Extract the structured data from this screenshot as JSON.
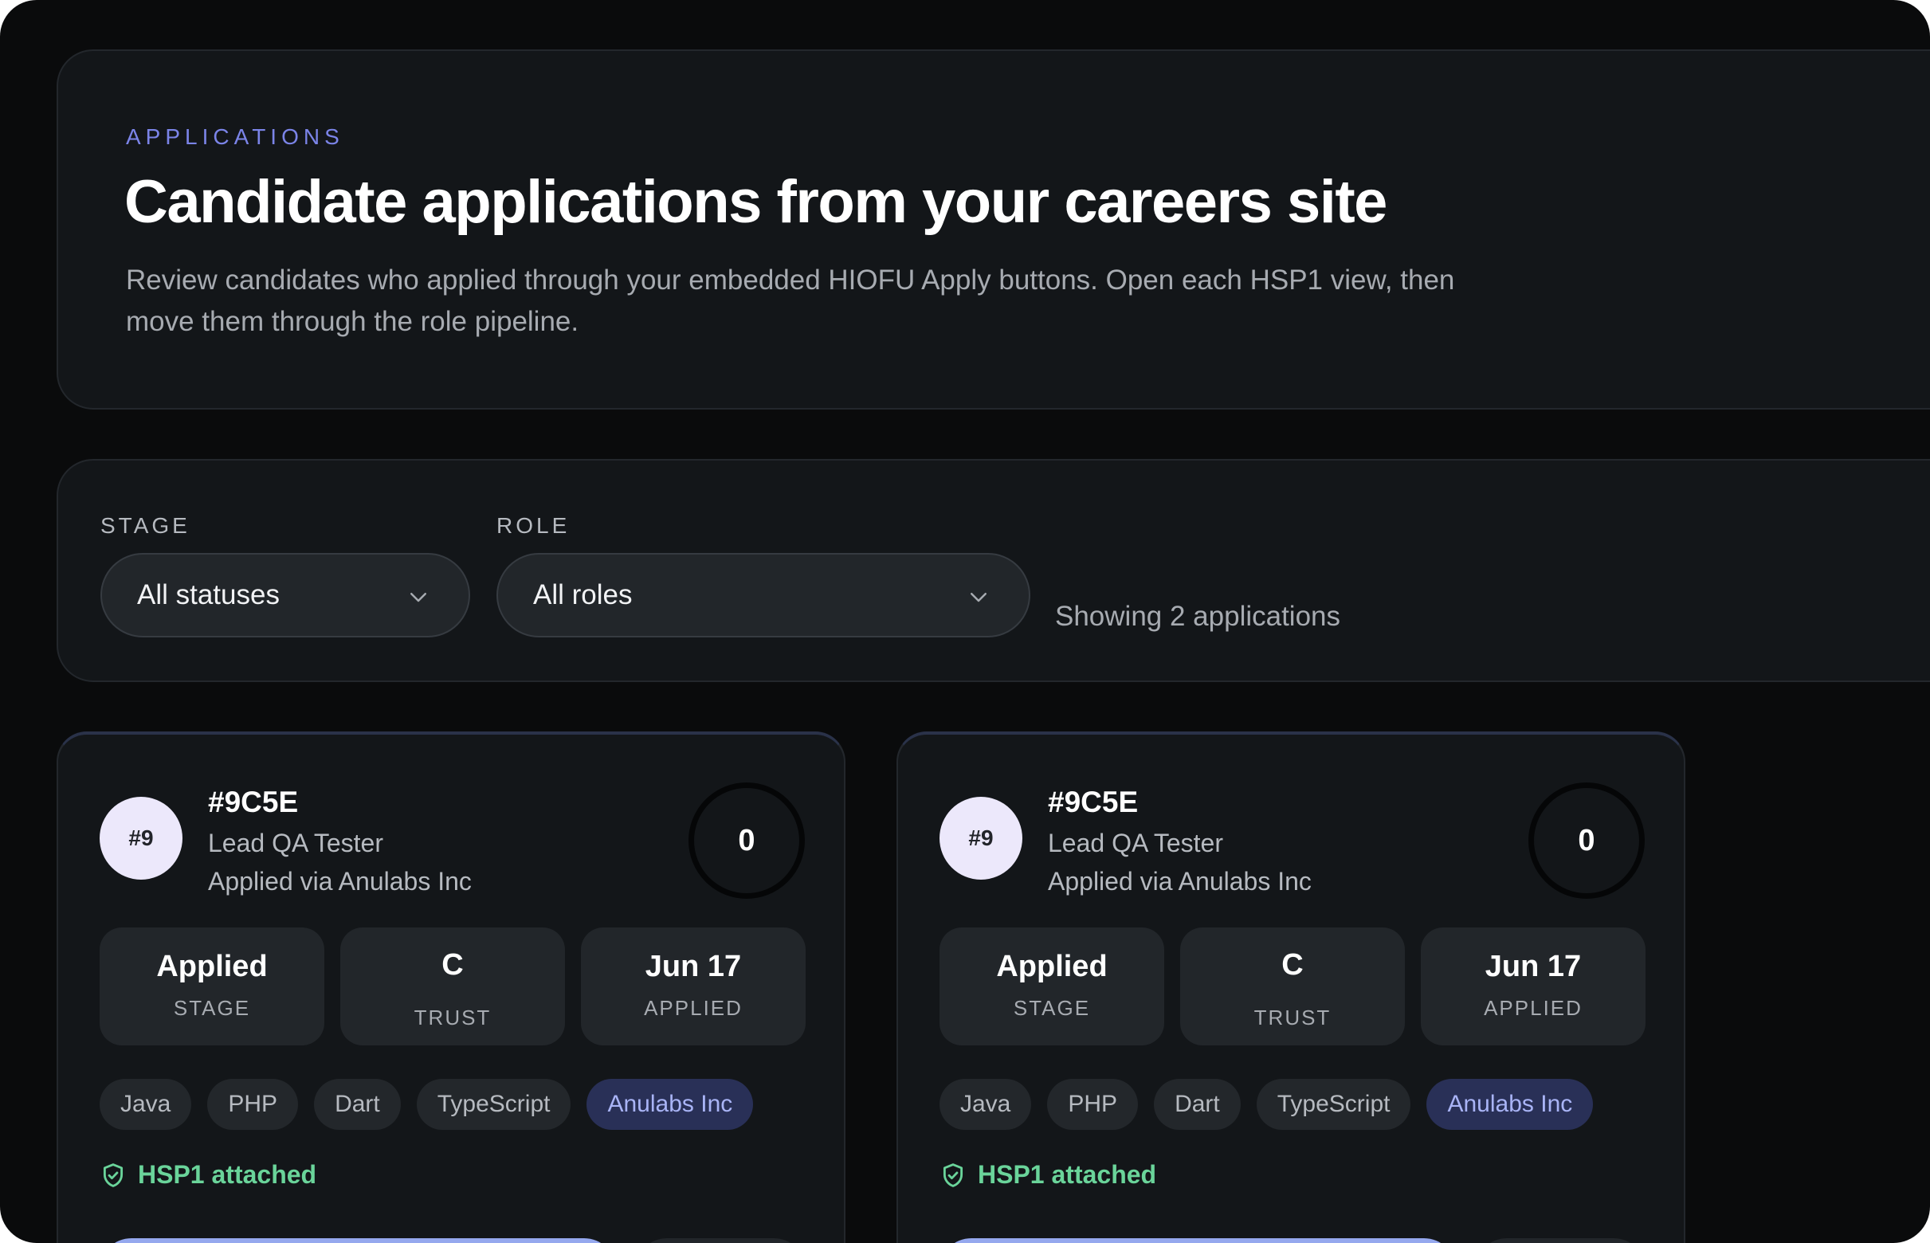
{
  "header": {
    "eyebrow": "APPLICATIONS",
    "title": "Candidate applications from your careers site",
    "description": "Review candidates who applied through your embedded HIOFU Apply buttons. Open each HSP1 view, then move them through the role pipeline."
  },
  "filters": {
    "stage_label": "STAGE",
    "stage_value": "All statuses",
    "role_label": "ROLE",
    "role_value": "All roles",
    "showing": "Showing 2 applications"
  },
  "applications": [
    {
      "rank": "#9",
      "id": "#9C5E",
      "role": "Lead QA Tester",
      "via": "Applied via Anulabs Inc",
      "score": "0",
      "stage_value": "Applied",
      "stage_label": "STAGE",
      "trust_value": "C",
      "trust_label": "TRUST",
      "date_value": "Jun 17",
      "date_label": "APPLIED",
      "skills": [
        "Java",
        "PHP",
        "Dart",
        "TypeScript"
      ],
      "company": "Anulabs Inc",
      "hsp_status": "HSP1 attached"
    },
    {
      "rank": "#9",
      "id": "#9C5E",
      "role": "Lead QA Tester",
      "via": "Applied via Anulabs Inc",
      "score": "0",
      "stage_value": "Applied",
      "stage_label": "STAGE",
      "trust_value": "C",
      "trust_label": "TRUST",
      "date_value": "Jun 17",
      "date_label": "APPLIED",
      "skills": [
        "Java",
        "PHP",
        "Dart",
        "TypeScript"
      ],
      "company": "Anulabs Inc",
      "hsp_status": "HSP1 attached"
    }
  ],
  "icons": {
    "dropdown": "chevron-down-icon",
    "hsp": "shield-check-icon"
  },
  "colors": {
    "accent": "#7b84e8",
    "success": "#6ad49a",
    "company_tag": "#293057",
    "primary_button": "#95a8ee"
  }
}
